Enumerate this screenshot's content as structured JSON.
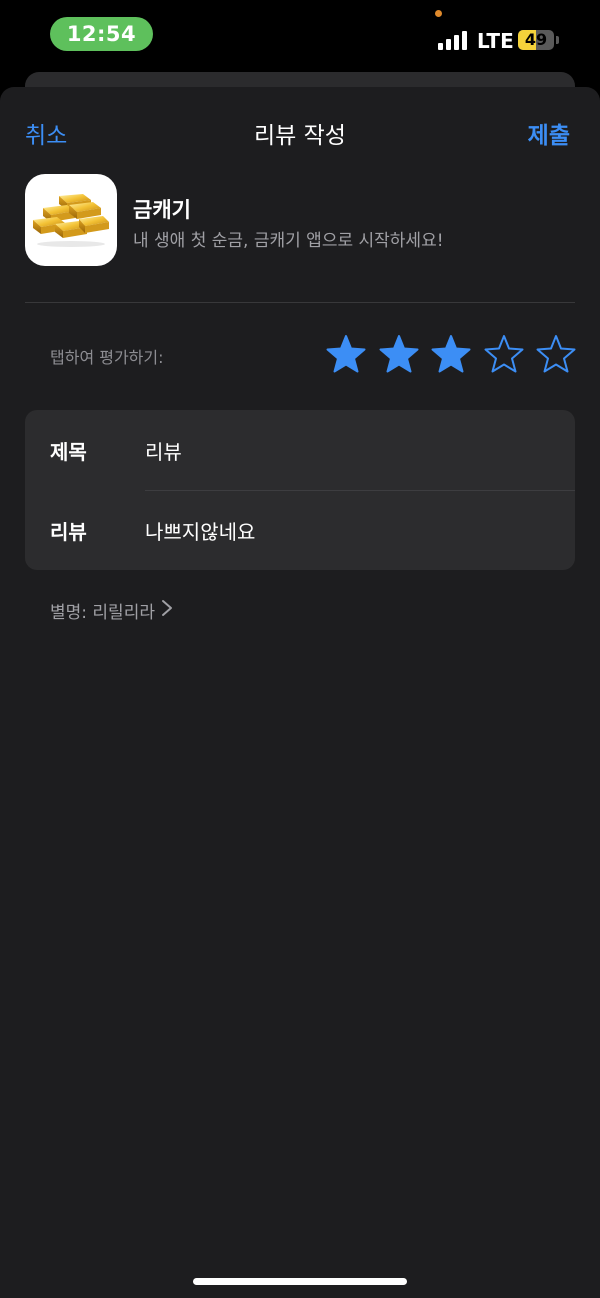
{
  "status_bar": {
    "time": "12:54",
    "network": "LTE",
    "battery_level": "49",
    "battery_fraction": 0.49,
    "signal_bars": 4,
    "time_pill_color": "#5ec05c",
    "battery_color": "#f5d33b"
  },
  "nav": {
    "cancel_label": "취소",
    "title": "리뷰 작성",
    "submit_label": "제출",
    "accent_color": "#3c8ef5"
  },
  "app": {
    "name": "금캐기",
    "subtitle": "내 생애 첫 순금, 금캐기 앱으로 시작하세요!",
    "icon": "gold-bars-icon"
  },
  "rating": {
    "label": "탭하여 평가하기:",
    "value": 3,
    "max": 5,
    "star_color": "#3c8ef5"
  },
  "form": {
    "title_label": "제목",
    "title_value": "리뷰",
    "review_label": "리뷰",
    "review_value": "나쁘지않네요"
  },
  "nickname": {
    "text": "별명: 리릴리라",
    "icon": "chevron-right-icon"
  }
}
